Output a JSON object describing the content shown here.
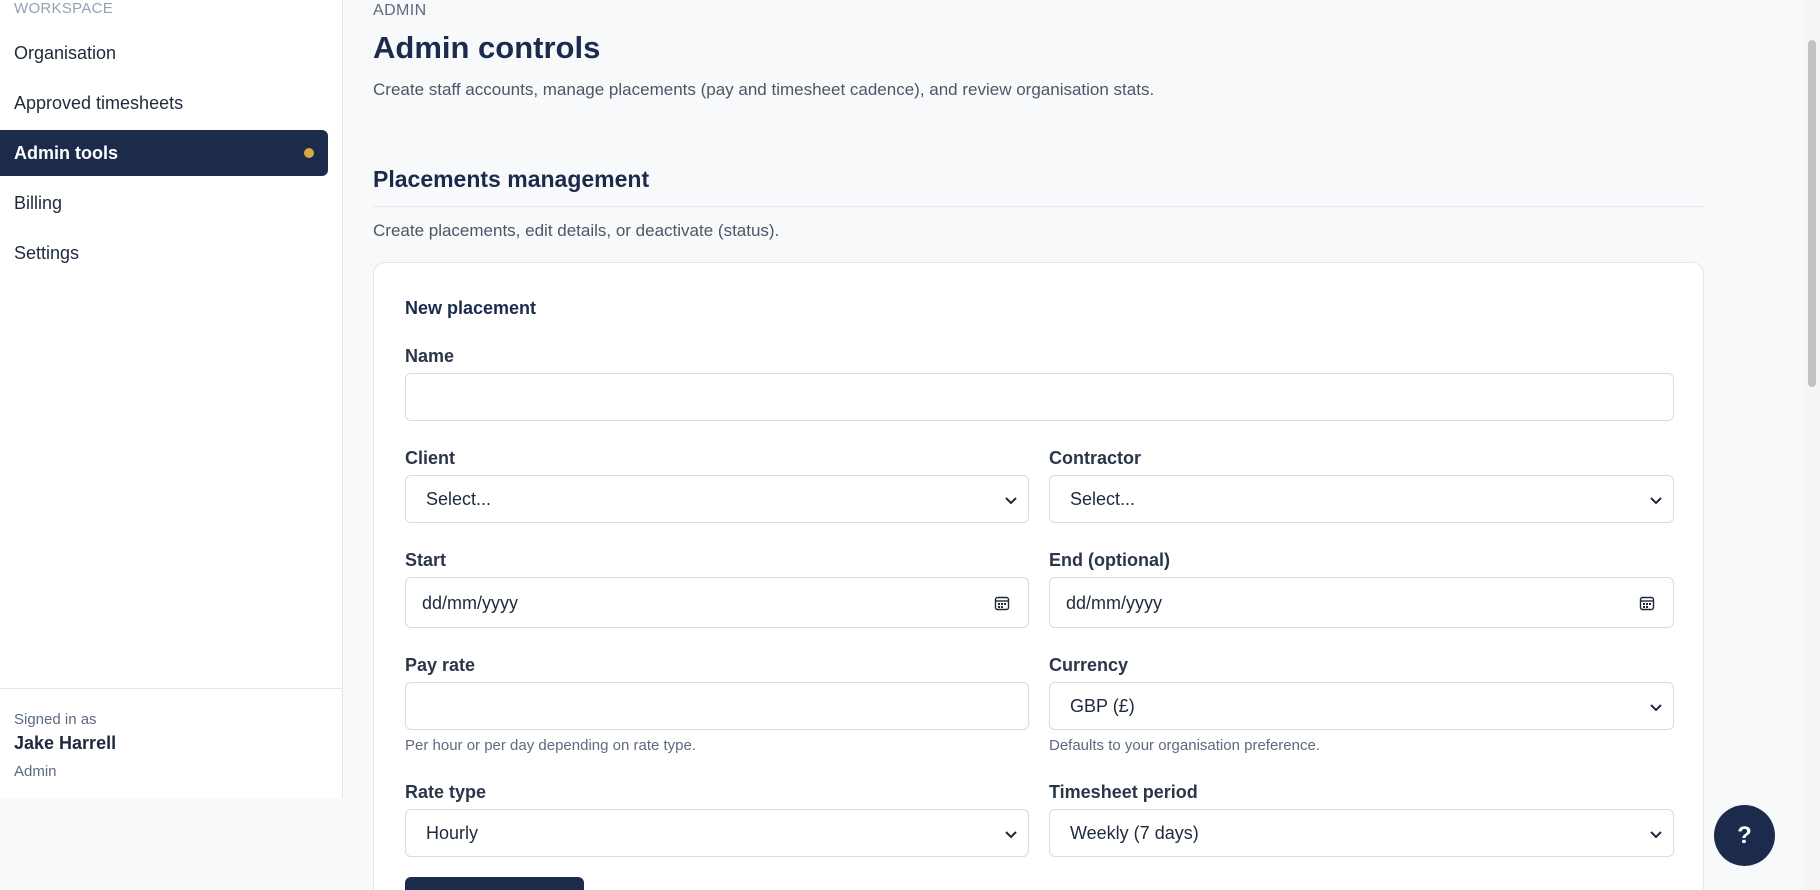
{
  "sidebar": {
    "section_label": "WORKSPACE",
    "items": [
      {
        "label": "Organisation"
      },
      {
        "label": "Approved timesheets"
      },
      {
        "label": "Admin tools"
      },
      {
        "label": "Billing"
      },
      {
        "label": "Settings"
      }
    ],
    "active_index": 2,
    "active_dot_color": "#d6a847",
    "signed_in_label": "Signed in as",
    "user_name": "Jake Harrell",
    "user_role": "Admin"
  },
  "header": {
    "eyebrow": "ADMIN",
    "title": "Admin controls",
    "description": "Create staff accounts, manage placements (pay and timesheet cadence), and review organisation stats."
  },
  "placements": {
    "title": "Placements management",
    "description": "Create placements, edit details, or deactivate (status).",
    "card_title": "New placement",
    "fields": {
      "name": {
        "label": "Name",
        "value": ""
      },
      "client": {
        "label": "Client",
        "value": "Select..."
      },
      "contractor": {
        "label": "Contractor",
        "value": "Select..."
      },
      "start": {
        "label": "Start",
        "value": "dd/mm/yyyy"
      },
      "end": {
        "label": "End (optional)",
        "value": "dd/mm/yyyy"
      },
      "pay_rate": {
        "label": "Pay rate",
        "value": "",
        "help": "Per hour or per day depending on rate type."
      },
      "currency": {
        "label": "Currency",
        "value": "GBP (£)",
        "help": "Defaults to your organisation preference."
      },
      "rate_type": {
        "label": "Rate type",
        "value": "Hourly"
      },
      "timesheet_period": {
        "label": "Timesheet period",
        "value": "Weekly (7 days)"
      }
    }
  },
  "help_button": {
    "label": "?"
  },
  "colors": {
    "primary": "#1c2b4b",
    "accent": "#d6a847"
  }
}
